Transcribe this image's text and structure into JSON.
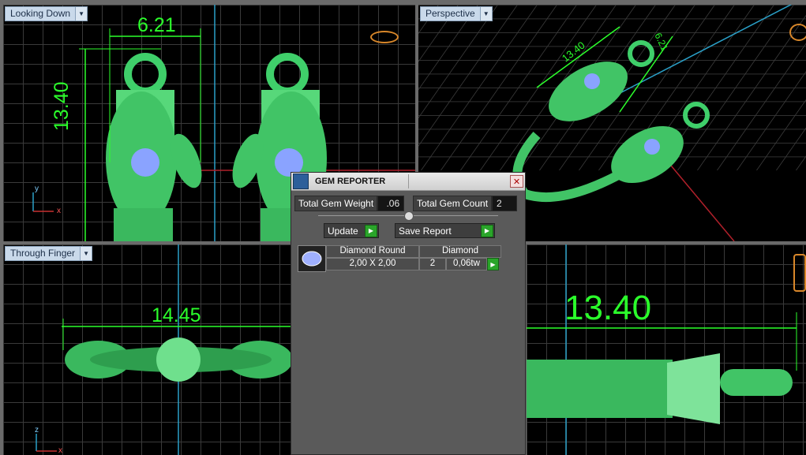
{
  "viewports": {
    "top_left": {
      "label": "Looking Down",
      "dim_width": "6.21",
      "dim_height": "13.40",
      "axis_y": "y",
      "axis_x": "x"
    },
    "top_right": {
      "label": "Perspective",
      "dim_a": "13.40",
      "dim_b": "6.21"
    },
    "bottom_left": {
      "label": "Through Finger",
      "dim_width": "14.45",
      "axis_z": "z",
      "axis_x": "x"
    },
    "bottom_right": {
      "dim_width": "13.40"
    }
  },
  "gem_reporter": {
    "title": "GEM REPORTER",
    "close_glyph": "✕",
    "total_weight_label": "Total Gem Weight",
    "total_weight_value": ".06",
    "total_count_label": "Total Gem Count",
    "total_count_value": "2",
    "update_label": "Update",
    "save_report_label": "Save Report",
    "gem_row": {
      "shape": "Diamond Round",
      "size": "2,00 X 2,00",
      "material": "Diamond",
      "count": "2",
      "weight": "0,06tw"
    }
  },
  "colors": {
    "dimension": "#2bff2b",
    "model": "#3fcf6a",
    "gem": "#8aa3ff",
    "axis_line": "#2aa0c8"
  },
  "icons": [
    "dropdown-arrow-icon",
    "gem-reporter-icon",
    "close-icon",
    "play-icon",
    "diamond-thumbnail-icon",
    "ring-icon"
  ]
}
